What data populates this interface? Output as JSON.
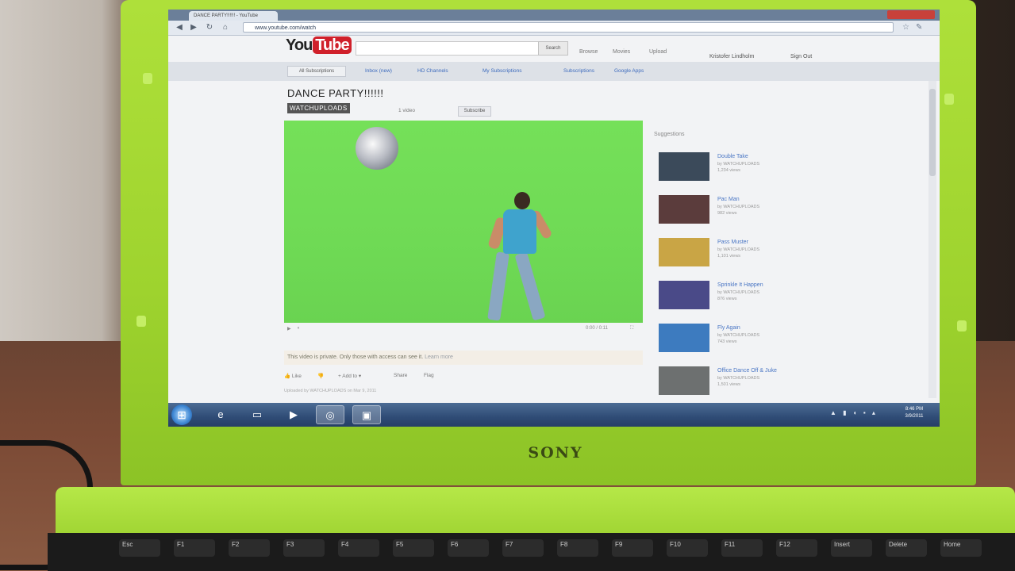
{
  "browser": {
    "tab_title": "DANCE PARTY!!!!!! - YouTube",
    "address": "www.youtube.com/watch",
    "colors": {
      "tabstrip": "#6b7f99",
      "close": "#c8413a"
    }
  },
  "youtube": {
    "logo_you": "You",
    "logo_tube": "Tube",
    "search_button": "Search",
    "header_links": [
      "Browse",
      "Movies",
      "Upload"
    ],
    "user_name": "Kristofer Lindholm",
    "sign_out": "Sign Out",
    "guide_button": "All Subscriptions",
    "guide_items": [
      "Inbox (new)",
      "HD Channels",
      "My Subscriptions",
      "Subscriptions",
      "Google Apps"
    ],
    "brand_color": "#d0202a"
  },
  "video": {
    "title": "DANCE PARTY!!!!!!",
    "uploader": "WATCHUPLOADS",
    "sub_line": "1 video",
    "subscribe_label": "Subscribe",
    "controls_time": "0:00 / 0:11",
    "private_notice": "This video is private. Only those with access can see it.",
    "learn_more": "Learn more",
    "actions": [
      "Like",
      "Add to",
      "Share",
      "Flag"
    ],
    "uploaded_line": "Uploaded by WATCHUPLOADS on Mar 9, 2011"
  },
  "suggestions": {
    "heading": "Suggestions",
    "items": [
      {
        "title": "Double Take",
        "meta": "by WATCHUPLOADS",
        "views": "1,234 views",
        "thumb": "#3b4a5a"
      },
      {
        "title": "Pac Man",
        "meta": "by WATCHUPLOADS",
        "views": "982 views",
        "thumb": "#5b3c3c"
      },
      {
        "title": "Pass Muster",
        "meta": "by WATCHUPLOADS",
        "views": "1,101 views",
        "thumb": "#c9a545"
      },
      {
        "title": "Sprinkle It Happen",
        "meta": "by WATCHUPLOADS",
        "views": "876 views",
        "thumb": "#4a4a88"
      },
      {
        "title": "Fly Again",
        "meta": "by WATCHUPLOADS",
        "views": "743 views",
        "thumb": "#3d7bbf"
      },
      {
        "title": "Office Dance Off & Juke",
        "meta": "by WATCHUPLOADS",
        "views": "1,501 views",
        "thumb": "#6d7070"
      }
    ]
  },
  "taskbar": {
    "start_icon": "windows-orb-icon",
    "apps": [
      {
        "name": "internet-explorer-icon",
        "glyph": "e",
        "active": false
      },
      {
        "name": "file-explorer-icon",
        "glyph": "▭",
        "active": false
      },
      {
        "name": "media-player-icon",
        "glyph": "▶",
        "active": false
      },
      {
        "name": "chrome-icon",
        "glyph": "◎",
        "active": true
      },
      {
        "name": "remote-desktop-icon",
        "glyph": "▣",
        "active": true
      }
    ],
    "tray_icons": "▲ ▮ ◖ ▪ ▴",
    "clock_time": "8:46 PM",
    "clock_date": "3/9/2011"
  },
  "laptop": {
    "brand": "SONY",
    "body_color": "#9ed32e"
  },
  "keyboard": {
    "keys": [
      "Esc",
      "F1",
      "F2",
      "F3",
      "F4",
      "F5",
      "F6",
      "F7",
      "F8",
      "F9",
      "F10",
      "F11",
      "F12",
      "Insert",
      "Delete",
      "Home"
    ]
  }
}
